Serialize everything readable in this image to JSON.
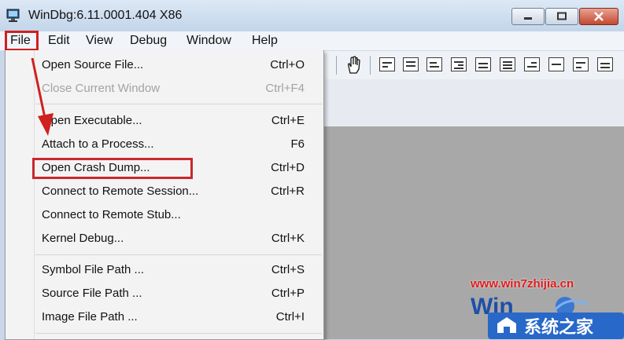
{
  "window": {
    "title": "WinDbg:6.11.0001.404 X86"
  },
  "menubar": {
    "items": [
      "File",
      "Edit",
      "View",
      "Debug",
      "Window",
      "Help"
    ]
  },
  "file_menu": {
    "items": [
      {
        "label": "Open Source File...",
        "shortcut": "Ctrl+O",
        "enabled": true
      },
      {
        "label": "Close Current Window",
        "shortcut": "Ctrl+F4",
        "enabled": false
      },
      {
        "label": "Open Executable...",
        "shortcut": "Ctrl+E",
        "enabled": true
      },
      {
        "label": "Attach to a Process...",
        "shortcut": "F6",
        "enabled": true
      },
      {
        "label": "Open Crash Dump...",
        "shortcut": "Ctrl+D",
        "enabled": true,
        "highlighted": true
      },
      {
        "label": "Connect to Remote Session...",
        "shortcut": "Ctrl+R",
        "enabled": true
      },
      {
        "label": "Connect to Remote Stub...",
        "shortcut": "",
        "enabled": true
      },
      {
        "label": "Kernel Debug...",
        "shortcut": "Ctrl+K",
        "enabled": true
      },
      {
        "label": "Symbol File Path ...",
        "shortcut": "Ctrl+S",
        "enabled": true
      },
      {
        "label": "Source File Path ...",
        "shortcut": "Ctrl+P",
        "enabled": true
      },
      {
        "label": "Image File Path ...",
        "shortcut": "Ctrl+I",
        "enabled": true
      }
    ]
  },
  "watermark": {
    "url": "www.win7zhijia.cn",
    "brand": "系统之家",
    "logo_text": "Win"
  },
  "colors": {
    "annotation_red": "#d02020",
    "watermark_red": "#e01a1a",
    "watermark_blue": "#1d4fa8"
  }
}
